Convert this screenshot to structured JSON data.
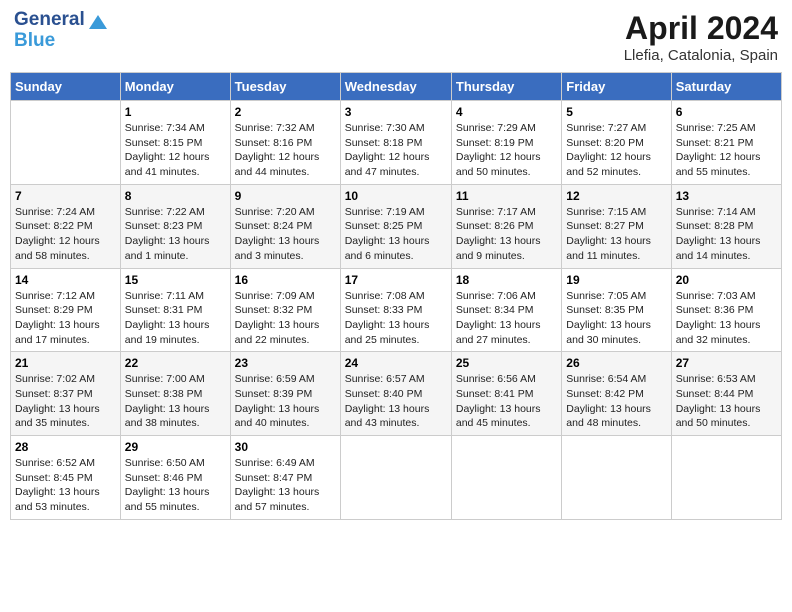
{
  "header": {
    "logo_line1": "General",
    "logo_line2": "Blue",
    "month": "April 2024",
    "location": "Llefia, Catalonia, Spain"
  },
  "weekdays": [
    "Sunday",
    "Monday",
    "Tuesday",
    "Wednesday",
    "Thursday",
    "Friday",
    "Saturday"
  ],
  "weeks": [
    [
      {
        "day": "",
        "text": ""
      },
      {
        "day": "1",
        "text": "Sunrise: 7:34 AM\nSunset: 8:15 PM\nDaylight: 12 hours\nand 41 minutes."
      },
      {
        "day": "2",
        "text": "Sunrise: 7:32 AM\nSunset: 8:16 PM\nDaylight: 12 hours\nand 44 minutes."
      },
      {
        "day": "3",
        "text": "Sunrise: 7:30 AM\nSunset: 8:18 PM\nDaylight: 12 hours\nand 47 minutes."
      },
      {
        "day": "4",
        "text": "Sunrise: 7:29 AM\nSunset: 8:19 PM\nDaylight: 12 hours\nand 50 minutes."
      },
      {
        "day": "5",
        "text": "Sunrise: 7:27 AM\nSunset: 8:20 PM\nDaylight: 12 hours\nand 52 minutes."
      },
      {
        "day": "6",
        "text": "Sunrise: 7:25 AM\nSunset: 8:21 PM\nDaylight: 12 hours\nand 55 minutes."
      }
    ],
    [
      {
        "day": "7",
        "text": "Sunrise: 7:24 AM\nSunset: 8:22 PM\nDaylight: 12 hours\nand 58 minutes."
      },
      {
        "day": "8",
        "text": "Sunrise: 7:22 AM\nSunset: 8:23 PM\nDaylight: 13 hours\nand 1 minute."
      },
      {
        "day": "9",
        "text": "Sunrise: 7:20 AM\nSunset: 8:24 PM\nDaylight: 13 hours\nand 3 minutes."
      },
      {
        "day": "10",
        "text": "Sunrise: 7:19 AM\nSunset: 8:25 PM\nDaylight: 13 hours\nand 6 minutes."
      },
      {
        "day": "11",
        "text": "Sunrise: 7:17 AM\nSunset: 8:26 PM\nDaylight: 13 hours\nand 9 minutes."
      },
      {
        "day": "12",
        "text": "Sunrise: 7:15 AM\nSunset: 8:27 PM\nDaylight: 13 hours\nand 11 minutes."
      },
      {
        "day": "13",
        "text": "Sunrise: 7:14 AM\nSunset: 8:28 PM\nDaylight: 13 hours\nand 14 minutes."
      }
    ],
    [
      {
        "day": "14",
        "text": "Sunrise: 7:12 AM\nSunset: 8:29 PM\nDaylight: 13 hours\nand 17 minutes."
      },
      {
        "day": "15",
        "text": "Sunrise: 7:11 AM\nSunset: 8:31 PM\nDaylight: 13 hours\nand 19 minutes."
      },
      {
        "day": "16",
        "text": "Sunrise: 7:09 AM\nSunset: 8:32 PM\nDaylight: 13 hours\nand 22 minutes."
      },
      {
        "day": "17",
        "text": "Sunrise: 7:08 AM\nSunset: 8:33 PM\nDaylight: 13 hours\nand 25 minutes."
      },
      {
        "day": "18",
        "text": "Sunrise: 7:06 AM\nSunset: 8:34 PM\nDaylight: 13 hours\nand 27 minutes."
      },
      {
        "day": "19",
        "text": "Sunrise: 7:05 AM\nSunset: 8:35 PM\nDaylight: 13 hours\nand 30 minutes."
      },
      {
        "day": "20",
        "text": "Sunrise: 7:03 AM\nSunset: 8:36 PM\nDaylight: 13 hours\nand 32 minutes."
      }
    ],
    [
      {
        "day": "21",
        "text": "Sunrise: 7:02 AM\nSunset: 8:37 PM\nDaylight: 13 hours\nand 35 minutes."
      },
      {
        "day": "22",
        "text": "Sunrise: 7:00 AM\nSunset: 8:38 PM\nDaylight: 13 hours\nand 38 minutes."
      },
      {
        "day": "23",
        "text": "Sunrise: 6:59 AM\nSunset: 8:39 PM\nDaylight: 13 hours\nand 40 minutes."
      },
      {
        "day": "24",
        "text": "Sunrise: 6:57 AM\nSunset: 8:40 PM\nDaylight: 13 hours\nand 43 minutes."
      },
      {
        "day": "25",
        "text": "Sunrise: 6:56 AM\nSunset: 8:41 PM\nDaylight: 13 hours\nand 45 minutes."
      },
      {
        "day": "26",
        "text": "Sunrise: 6:54 AM\nSunset: 8:42 PM\nDaylight: 13 hours\nand 48 minutes."
      },
      {
        "day": "27",
        "text": "Sunrise: 6:53 AM\nSunset: 8:44 PM\nDaylight: 13 hours\nand 50 minutes."
      }
    ],
    [
      {
        "day": "28",
        "text": "Sunrise: 6:52 AM\nSunset: 8:45 PM\nDaylight: 13 hours\nand 53 minutes."
      },
      {
        "day": "29",
        "text": "Sunrise: 6:50 AM\nSunset: 8:46 PM\nDaylight: 13 hours\nand 55 minutes."
      },
      {
        "day": "30",
        "text": "Sunrise: 6:49 AM\nSunset: 8:47 PM\nDaylight: 13 hours\nand 57 minutes."
      },
      {
        "day": "",
        "text": ""
      },
      {
        "day": "",
        "text": ""
      },
      {
        "day": "",
        "text": ""
      },
      {
        "day": "",
        "text": ""
      }
    ]
  ]
}
